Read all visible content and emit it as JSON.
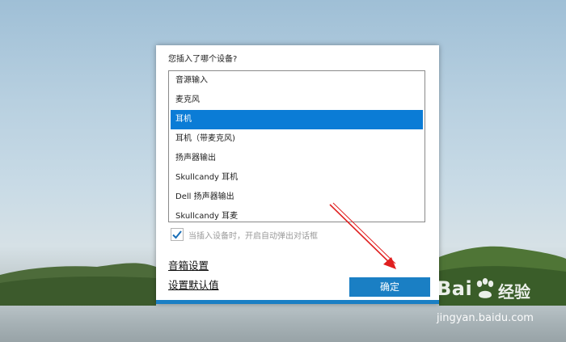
{
  "dialog": {
    "question": "您插入了哪个设备?",
    "devices": [
      "音源输入",
      "麦克风",
      "耳机",
      "耳机（带麦克风)",
      "扬声器输出",
      "Skullcandy 耳机",
      "Dell 扬声器输出",
      "Skullcandy 耳麦"
    ],
    "selected_device": "耳机",
    "auto_popup_label": "当插入设备时，开启自动弹出对话框",
    "auto_popup_checked": true,
    "speaker_settings_link": "音箱设置",
    "set_default_link": "设置默认值",
    "ok_button": "确定"
  },
  "watermark": {
    "brand": "Bai",
    "brand_suffix": "经验",
    "url": "jingyan.baidu.com"
  },
  "colors": {
    "accent": "#1a7fc4",
    "selection": "#0b7cd6",
    "annotation_arrow": "#e02020"
  }
}
